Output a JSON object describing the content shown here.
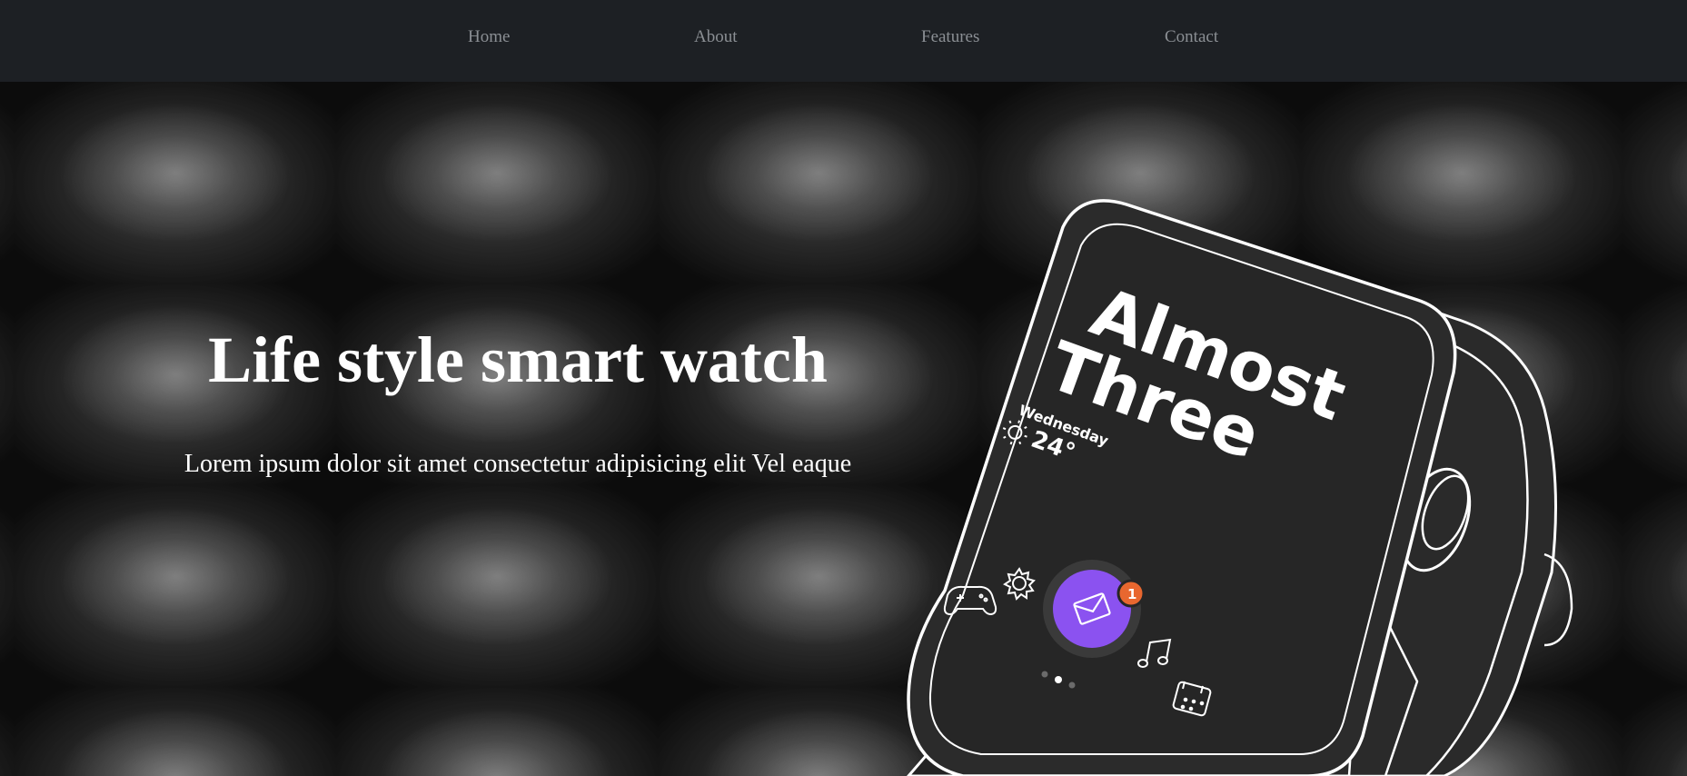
{
  "nav": {
    "items": [
      {
        "label": "Home"
      },
      {
        "label": "About"
      },
      {
        "label": "Features"
      },
      {
        "label": "Contact"
      }
    ]
  },
  "hero": {
    "title": "Life style smart watch",
    "text": "Lorem ipsum dolor sit amet consectetur adipisicing elit Vel eaque"
  },
  "watch_screen": {
    "headline_line1": "Almost",
    "headline_line2": "Three",
    "day": "Wednesday",
    "temperature": "24°",
    "notification_count": "1"
  },
  "colors": {
    "nav_bg": "#1d2024",
    "nav_text": "#8b8f94",
    "accent_purple": "#8b52f0",
    "badge_orange": "#e8672f",
    "watch_body": "#2b2b2b"
  }
}
